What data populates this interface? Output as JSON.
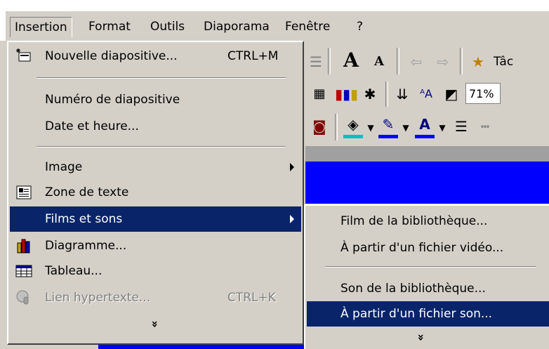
{
  "menubar": {
    "items": [
      {
        "label": "Insertion"
      },
      {
        "label": "Format"
      },
      {
        "label": "Outils"
      },
      {
        "label": "Diaporama"
      },
      {
        "label": "Fenêtre"
      },
      {
        "label": "?"
      }
    ]
  },
  "toolbar": {
    "zoom": "71%",
    "tasks_label": "Tâc"
  },
  "menu": {
    "items": [
      {
        "label": "Nouvelle diapositive...",
        "shortcut": "CTRL+M",
        "icon": "new-slide-icon"
      },
      {
        "label": "Numéro de diapositive"
      },
      {
        "label": "Date et heure..."
      },
      {
        "label": "Image",
        "submenu": true
      },
      {
        "label": "Zone de texte",
        "icon": "text-box-icon"
      },
      {
        "label": "Films et sons",
        "submenu": true,
        "highlighted": true
      },
      {
        "label": "Diagramme...",
        "icon": "chart-icon"
      },
      {
        "label": "Tableau...",
        "icon": "table-icon"
      },
      {
        "label": "Lien hypertexte...",
        "shortcut": "CTRL+K",
        "icon": "hyperlink-icon",
        "disabled": true
      }
    ],
    "more": "»"
  },
  "submenu": {
    "items": [
      {
        "label": "Film de la bibliothèque..."
      },
      {
        "label": "À partir d'un fichier vidéo..."
      },
      {
        "label": "Son de la bibliothèque..."
      },
      {
        "label": "À partir d'un fichier son...",
        "highlighted": true
      }
    ],
    "more": "»"
  },
  "colors": {
    "menu_bg": "#d4d0c8",
    "highlight": "#0a246a",
    "slide_blue": "#0000ff"
  }
}
